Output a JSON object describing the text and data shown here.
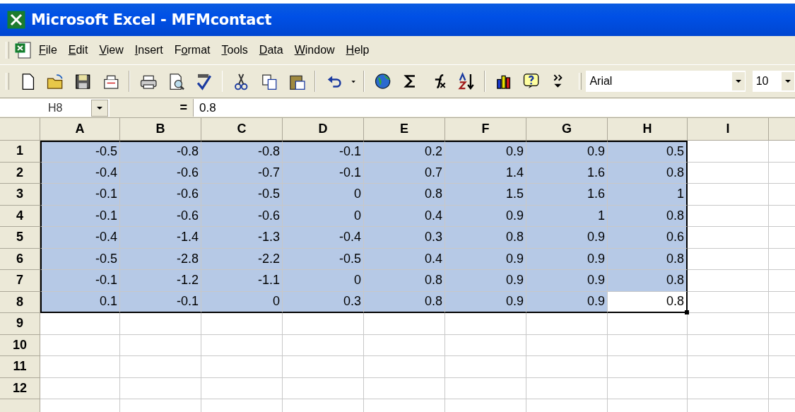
{
  "window": {
    "title": "Microsoft Excel - MFMcontact"
  },
  "menu": [
    {
      "label": "File"
    },
    {
      "label": "Edit"
    },
    {
      "label": "View"
    },
    {
      "label": "Insert"
    },
    {
      "label": "Format"
    },
    {
      "label": "Tools"
    },
    {
      "label": "Data"
    },
    {
      "label": "Window"
    },
    {
      "label": "Help"
    }
  ],
  "toolbar": {
    "font": "Arial",
    "size": "10"
  },
  "formula_bar": {
    "name_box": "H8",
    "equals": "=",
    "value": "0.8"
  },
  "sheet": {
    "columns": [
      "A",
      "B",
      "C",
      "D",
      "E",
      "F",
      "G",
      "H",
      "I"
    ],
    "rows": [
      {
        "header": "1",
        "cells": [
          {
            "v": "-0.5",
            "selected": true,
            "active": false
          },
          {
            "v": "-0.8",
            "selected": true,
            "active": false
          },
          {
            "v": "-0.8",
            "selected": true,
            "active": false
          },
          {
            "v": "-0.1",
            "selected": true,
            "active": false
          },
          {
            "v": "0.2",
            "selected": true,
            "active": false
          },
          {
            "v": "0.9",
            "selected": true,
            "active": false
          },
          {
            "v": "0.9",
            "selected": true,
            "active": false
          },
          {
            "v": "0.5",
            "selected": true,
            "active": false
          }
        ]
      },
      {
        "header": "2",
        "cells": [
          {
            "v": "-0.4",
            "selected": true,
            "active": false
          },
          {
            "v": "-0.6",
            "selected": true,
            "active": false
          },
          {
            "v": "-0.7",
            "selected": true,
            "active": false
          },
          {
            "v": "-0.1",
            "selected": true,
            "active": false
          },
          {
            "v": "0.7",
            "selected": true,
            "active": false
          },
          {
            "v": "1.4",
            "selected": true,
            "active": false
          },
          {
            "v": "1.6",
            "selected": true,
            "active": false
          },
          {
            "v": "0.8",
            "selected": true,
            "active": false
          }
        ]
      },
      {
        "header": "3",
        "cells": [
          {
            "v": "-0.1",
            "selected": true,
            "active": false
          },
          {
            "v": "-0.6",
            "selected": true,
            "active": false
          },
          {
            "v": "-0.5",
            "selected": true,
            "active": false
          },
          {
            "v": "0",
            "selected": true,
            "active": false
          },
          {
            "v": "0.8",
            "selected": true,
            "active": false
          },
          {
            "v": "1.5",
            "selected": true,
            "active": false
          },
          {
            "v": "1.6",
            "selected": true,
            "active": false
          },
          {
            "v": "1",
            "selected": true,
            "active": false
          }
        ]
      },
      {
        "header": "4",
        "cells": [
          {
            "v": "-0.1",
            "selected": true,
            "active": false
          },
          {
            "v": "-0.6",
            "selected": true,
            "active": false
          },
          {
            "v": "-0.6",
            "selected": true,
            "active": false
          },
          {
            "v": "0",
            "selected": true,
            "active": false
          },
          {
            "v": "0.4",
            "selected": true,
            "active": false
          },
          {
            "v": "0.9",
            "selected": true,
            "active": false
          },
          {
            "v": "1",
            "selected": true,
            "active": false
          },
          {
            "v": "0.8",
            "selected": true,
            "active": false
          }
        ]
      },
      {
        "header": "5",
        "cells": [
          {
            "v": "-0.4",
            "selected": true,
            "active": false
          },
          {
            "v": "-1.4",
            "selected": true,
            "active": false
          },
          {
            "v": "-1.3",
            "selected": true,
            "active": false
          },
          {
            "v": "-0.4",
            "selected": true,
            "active": false
          },
          {
            "v": "0.3",
            "selected": true,
            "active": false
          },
          {
            "v": "0.8",
            "selected": true,
            "active": false
          },
          {
            "v": "0.9",
            "selected": true,
            "active": false
          },
          {
            "v": "0.6",
            "selected": true,
            "active": false
          }
        ]
      },
      {
        "header": "6",
        "cells": [
          {
            "v": "-0.5",
            "selected": true,
            "active": false
          },
          {
            "v": "-2.8",
            "selected": true,
            "active": false
          },
          {
            "v": "-2.2",
            "selected": true,
            "active": false
          },
          {
            "v": "-0.5",
            "selected": true,
            "active": false
          },
          {
            "v": "0.4",
            "selected": true,
            "active": false
          },
          {
            "v": "0.9",
            "selected": true,
            "active": false
          },
          {
            "v": "0.9",
            "selected": true,
            "active": false
          },
          {
            "v": "0.8",
            "selected": true,
            "active": false
          }
        ]
      },
      {
        "header": "7",
        "cells": [
          {
            "v": "-0.1",
            "selected": true,
            "active": false
          },
          {
            "v": "-1.2",
            "selected": true,
            "active": false
          },
          {
            "v": "-1.1",
            "selected": true,
            "active": false
          },
          {
            "v": "0",
            "selected": true,
            "active": false
          },
          {
            "v": "0.8",
            "selected": true,
            "active": false
          },
          {
            "v": "0.9",
            "selected": true,
            "active": false
          },
          {
            "v": "0.9",
            "selected": true,
            "active": false
          },
          {
            "v": "0.8",
            "selected": true,
            "active": false
          }
        ]
      },
      {
        "header": "8",
        "cells": [
          {
            "v": "0.1",
            "selected": true,
            "active": false
          },
          {
            "v": "-0.1",
            "selected": true,
            "active": false
          },
          {
            "v": "0",
            "selected": true,
            "active": false
          },
          {
            "v": "0.3",
            "selected": true,
            "active": false
          },
          {
            "v": "0.8",
            "selected": true,
            "active": false
          },
          {
            "v": "0.9",
            "selected": true,
            "active": false
          },
          {
            "v": "0.9",
            "selected": true,
            "active": false
          },
          {
            "v": "0.8",
            "selected": true,
            "active": true
          }
        ]
      },
      {
        "header": "9",
        "cells": []
      },
      {
        "header": "10",
        "cells": []
      },
      {
        "header": "11",
        "cells": []
      },
      {
        "header": "12",
        "cells": []
      }
    ]
  }
}
